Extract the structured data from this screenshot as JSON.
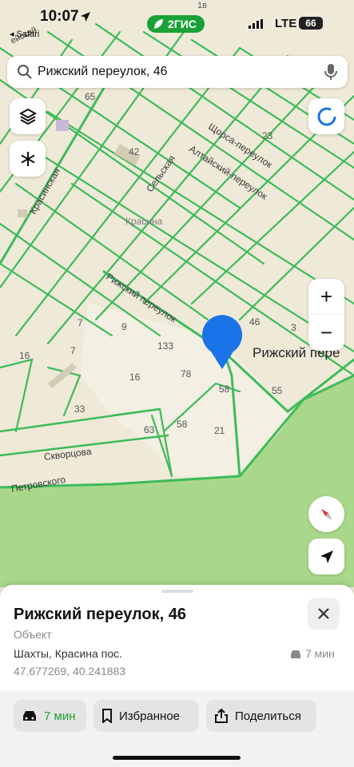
{
  "status_bar": {
    "time": "10:07",
    "back_label": "◂ Safari",
    "network": "LTE",
    "battery": "66"
  },
  "brand": {
    "label": "2ГИС",
    "color": "#1ba136"
  },
  "search": {
    "query": "Рижский переулок, 46",
    "search_icon": "search-icon",
    "mic_icon": "microphone-icon"
  },
  "map_controls": {
    "layers_icon": "layers-icon",
    "snowflake_icon": "snowflake-icon",
    "compass_circle_icon": "circle-progress-icon",
    "zoom_in": "+",
    "zoom_out": "−",
    "north_arrow_icon": "compass-icon",
    "locate_icon": "location-arrow-icon"
  },
  "map": {
    "streets": {
      "krasinskaya": "Красинская",
      "selskaya": "Сельская",
      "shchorsa": "Щорса-переулок",
      "altaysky": "Алтайский-переулок",
      "rizhsky": "Рижский переулок",
      "skvortsova": "Скворцова",
      "petrovskogo": "Петровского",
      "top_left": "ейский"
    },
    "labels": {
      "district": "Красина",
      "n65": "65",
      "n42": "42",
      "n23": "23",
      "n7a": "7",
      "n9": "9",
      "n7b": "7",
      "n16a": "16",
      "n133": "133",
      "n16b": "16",
      "n78": "78",
      "n46": "46",
      "n3": "3",
      "n58a": "58",
      "n55": "55",
      "n33": "33",
      "n58b": "58",
      "n63": "63",
      "n21": "21",
      "n1b": "1в"
    },
    "place_label": "Рижский пере",
    "colors": {
      "road": "#3dbb5a",
      "land": "#efe9d8",
      "forest": "#a9d88b",
      "pin": "#1a73e8"
    }
  },
  "sheet": {
    "title": "Рижский переулок, 46",
    "subtitle": "Объект",
    "city": "Шахты, Красина пос.",
    "coords": "47.677269, 40.241883",
    "eta": "7 мин",
    "close_icon": "close-icon",
    "car_icon": "car-icon"
  },
  "actions": {
    "route": {
      "label": "7 мин",
      "icon": "car-icon"
    },
    "favorite": {
      "label": "Избранное",
      "icon": "bookmark-icon"
    },
    "share": {
      "label": "Поделиться",
      "icon": "share-icon"
    }
  }
}
